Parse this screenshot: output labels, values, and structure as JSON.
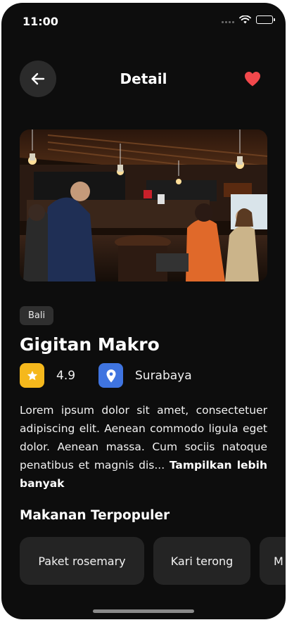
{
  "status_bar": {
    "time": "11:00"
  },
  "header": {
    "title": "Detail"
  },
  "place": {
    "tag": "Bali",
    "name": "Gigitan Makro",
    "rating": "4.9",
    "location": "Surabaya",
    "description": "Lorem ipsum dolor sit amet, consectetuer adipiscing elit. Aenean commodo ligula eget dolor. Aenean massa. Cum sociis natoque penatibus et magnis dis...",
    "read_more": "Tampilkan lebih banyak"
  },
  "popular": {
    "title": "Makanan Terpopuler",
    "items": [
      {
        "label": "Paket rosemary"
      },
      {
        "label": "Kari terong"
      },
      {
        "label": "M"
      }
    ]
  },
  "colors": {
    "background": "#0d0d0d",
    "heart": "#f2484c",
    "rating_icon": "#f5b81c",
    "location_icon": "#3f74e0"
  },
  "icons": [
    "back-arrow-icon",
    "heart-icon",
    "star-icon",
    "location-pin-icon",
    "wifi-icon",
    "battery-icon",
    "signal-icon"
  ]
}
